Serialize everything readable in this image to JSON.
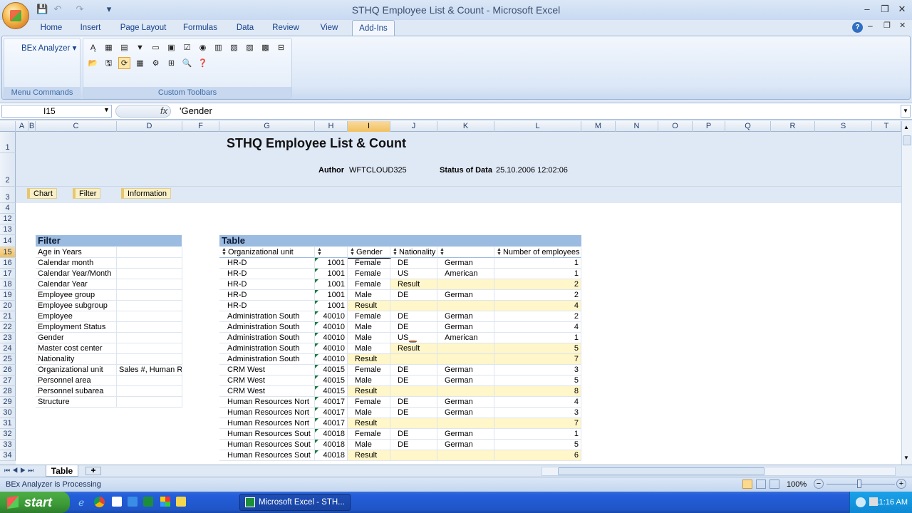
{
  "window": {
    "title": "STHQ Employee List & Count - Microsoft Excel"
  },
  "qat": {
    "save": "💾",
    "undo": "↶",
    "redo": "↷",
    "more": "▾"
  },
  "tabs": [
    "Home",
    "Insert",
    "Page Layout",
    "Formulas",
    "Data",
    "Review",
    "View",
    "Add-Ins"
  ],
  "active_tab": "Add-Ins",
  "ribbon": {
    "bex_button": "BEx Analyzer",
    "menu_group_label": "Menu Commands",
    "toolbar_group_label": "Custom Toolbars"
  },
  "formula": {
    "cell_ref": "I15",
    "fx": "fx",
    "content": "'Gender"
  },
  "columns": [
    "A",
    "B",
    "C",
    "D",
    "F",
    "G",
    "H",
    "I",
    "J",
    "K",
    "L",
    "M",
    "N",
    "O",
    "P",
    "Q",
    "R",
    "S",
    "T"
  ],
  "rows": [
    "1",
    "2",
    "3",
    "4",
    "12",
    "13",
    "14",
    "15",
    "16",
    "17",
    "18",
    "19",
    "20",
    "21",
    "22",
    "23",
    "24",
    "25",
    "26",
    "27",
    "28",
    "29",
    "30",
    "31",
    "32",
    "33",
    "34"
  ],
  "report": {
    "title": "STHQ Employee List & Count",
    "author_label": "Author",
    "author": "WFTCLOUD325",
    "status_label": "Status of Data",
    "status": "25.10.2006 12:02:06",
    "nav": [
      "Chart",
      "Filter",
      "Information"
    ]
  },
  "filter": {
    "title": "Filter",
    "items": [
      "Age in Years",
      "Calendar month",
      "Calendar Year/Month",
      "Calendar Year",
      "Employee group",
      "Employee subgroup",
      "Employee",
      "Employment Status",
      "Gender",
      "Master cost center",
      "Nationality",
      "Organizational unit",
      "Personnel area",
      "Personnel subarea",
      "Structure"
    ],
    "org_value": "Sales #, Human Re"
  },
  "table": {
    "title": "Table",
    "headers": [
      "Organizational unit",
      "",
      "Gender",
      "Nationality",
      "",
      "Number of employees"
    ],
    "rows": [
      [
        "HR-D",
        "1001",
        "Female",
        "DE",
        "German",
        "1"
      ],
      [
        "HR-D",
        "1001",
        "Female",
        "US",
        "American",
        "1"
      ],
      [
        "HR-D",
        "1001",
        "Female",
        "Result",
        "",
        "2"
      ],
      [
        "HR-D",
        "1001",
        "Male",
        "DE",
        "German",
        "2"
      ],
      [
        "HR-D",
        "1001",
        "Result",
        "",
        "",
        "4"
      ],
      [
        "Administration South",
        "40010",
        "Female",
        "DE",
        "German",
        "2"
      ],
      [
        "Administration South",
        "40010",
        "Male",
        "DE",
        "German",
        "4"
      ],
      [
        "Administration South",
        "40010",
        "Male",
        "US",
        "American",
        "1"
      ],
      [
        "Administration South",
        "40010",
        "Male",
        "Result",
        "",
        "5"
      ],
      [
        "Administration South",
        "40010",
        "Result",
        "",
        "",
        "7"
      ],
      [
        "CRM West",
        "40015",
        "Female",
        "DE",
        "German",
        "3"
      ],
      [
        "CRM West",
        "40015",
        "Male",
        "DE",
        "German",
        "5"
      ],
      [
        "CRM West",
        "40015",
        "Result",
        "",
        "",
        "8"
      ],
      [
        "Human Resources Nort",
        "40017",
        "Female",
        "DE",
        "German",
        "4"
      ],
      [
        "Human Resources Nort",
        "40017",
        "Male",
        "DE",
        "German",
        "3"
      ],
      [
        "Human Resources Nort",
        "40017",
        "Result",
        "",
        "",
        "7"
      ],
      [
        "Human Resources Sout",
        "40018",
        "Female",
        "DE",
        "German",
        "1"
      ],
      [
        "Human Resources Sout",
        "40018",
        "Male",
        "DE",
        "German",
        "5"
      ],
      [
        "Human Resources Sout",
        "40018",
        "Result",
        "",
        "",
        "6"
      ]
    ]
  },
  "sheet_tab": "Table",
  "status": {
    "text": "BEx Analyzer is Processing",
    "zoom": "100%"
  },
  "taskbar": {
    "start": "start",
    "excel_task": "Microsoft Excel - STH...",
    "clock": "11:16 AM"
  }
}
